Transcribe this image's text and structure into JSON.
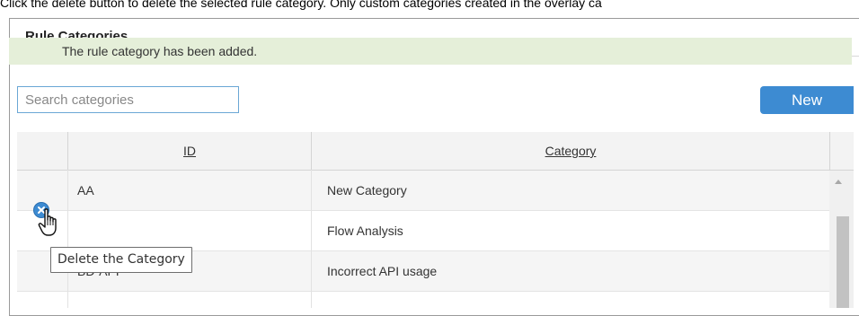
{
  "caption": "Click the delete button to delete the selected rule category. Only custom categories created in the overlay ca",
  "panel": {
    "title": "Rule Categories",
    "alert": "The rule category has been added."
  },
  "toolbar": {
    "search_placeholder": "Search categories",
    "new_label": "New"
  },
  "grid": {
    "columns": {
      "id": "ID",
      "category": "Category"
    },
    "rows": [
      {
        "id": "AA",
        "category": "New Category"
      },
      {
        "id": "",
        "category": "Flow Analysis"
      },
      {
        "id": "BD-API",
        "category": "Incorrect API usage"
      }
    ]
  },
  "tooltip": "Delete the Category",
  "icons": {
    "delete": "delete-icon",
    "cursor": "hand-pointer-icon",
    "scroll_up": "scroll-up-arrow-icon"
  },
  "colors": {
    "accent": "#3d8bd2",
    "alert_bg": "#e5efd9",
    "header_bg": "#f3f3f3"
  }
}
